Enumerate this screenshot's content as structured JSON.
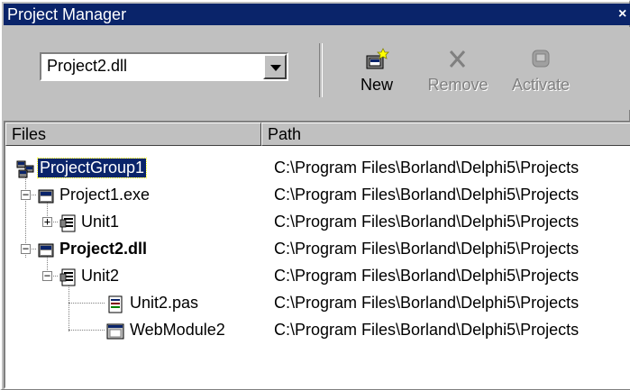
{
  "window": {
    "title": "Project Manager",
    "close_glyph": "×"
  },
  "toolbar": {
    "project_select": "Project2.dll",
    "buttons": [
      {
        "label": "New",
        "icon": "new-project-icon",
        "enabled": true
      },
      {
        "label": "Remove",
        "icon": "remove-icon",
        "enabled": false
      },
      {
        "label": "Activate",
        "icon": "activate-icon",
        "enabled": false
      }
    ]
  },
  "columns": {
    "files": "Files",
    "path": "Path"
  },
  "tree": [
    {
      "name": "ProjectGroup1",
      "path": "C:\\Program Files\\Borland\\Delphi5\\Projects",
      "icon": "project-group-icon",
      "level": 0,
      "selected": true
    },
    {
      "name": "Project1.exe",
      "path": "C:\\Program Files\\Borland\\Delphi5\\Projects",
      "icon": "project-exe-icon",
      "level": 1,
      "expander": "−"
    },
    {
      "name": "Unit1",
      "path": "C:\\Program Files\\Borland\\Delphi5\\Projects",
      "icon": "unit-icon",
      "level": 2,
      "expander": "+"
    },
    {
      "name": "Project2.dll",
      "path": "C:\\Program Files\\Borland\\Delphi5\\Projects",
      "icon": "project-dll-icon",
      "level": 1,
      "expander": "−",
      "bold": true
    },
    {
      "name": "Unit2",
      "path": "C:\\Program Files\\Borland\\Delphi5\\Projects",
      "icon": "unit-icon",
      "level": 2,
      "expander": "−"
    },
    {
      "name": "Unit2.pas",
      "path": "C:\\Program Files\\Borland\\Delphi5\\Projects",
      "icon": "pas-file-icon",
      "level": 3
    },
    {
      "name": "WebModule2",
      "path": "C:\\Program Files\\Borland\\Delphi5\\Projects",
      "icon": "web-module-icon",
      "level": 3
    }
  ],
  "colors": {
    "titlebar": "#0a246a",
    "selection": "#0a246a",
    "face": "#c0c0c0"
  }
}
